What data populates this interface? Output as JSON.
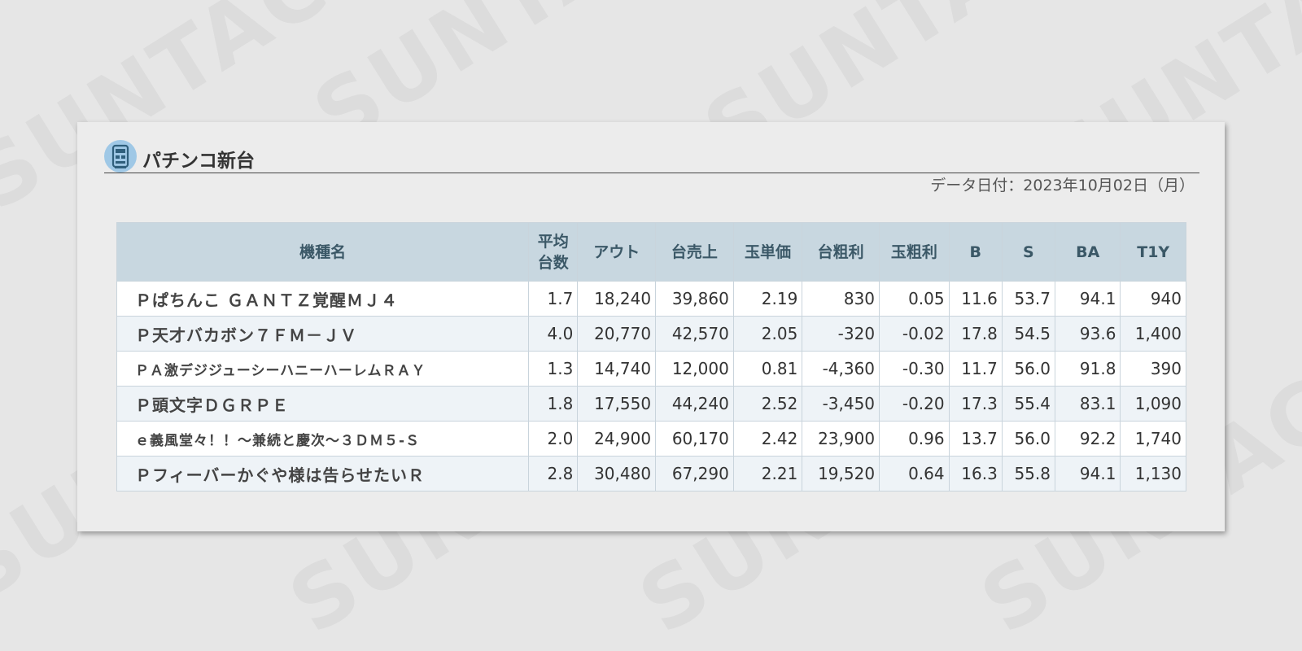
{
  "watermark": {
    "text": "SUNTAC"
  },
  "panel": {
    "title": "パチンコ新台",
    "title_icon": "pachinko-machine-icon",
    "data_date": "データ日付：2023年10月02日（月）"
  },
  "colors": {
    "header_bg": "#c8d7e0",
    "header_text": "#3b5867",
    "row_alt_bg": "#eef3f7",
    "icon_bg": "#9fc8e6"
  },
  "table": {
    "headers": {
      "name": "機種名",
      "avg_units": "平均台数",
      "out": "アウト",
      "sales": "台売上",
      "ball_price": "玉単価",
      "gross_profit": "台粗利",
      "ball_profit": "玉粗利",
      "b": "B",
      "s": "S",
      "ba": "BA",
      "t1y": "T1Y"
    },
    "rows": [
      {
        "name": "Ｐぱちんこ ＧＡＮＴＺ覚醒ＭＪ４",
        "avg_units": "1.7",
        "out": "18,240",
        "sales": "39,860",
        "ball_price": "2.19",
        "gross_profit": "830",
        "ball_profit": "0.05",
        "b": "11.6",
        "s": "53.7",
        "ba": "94.1",
        "t1y": "940"
      },
      {
        "name": "Ｐ天才バカボン７ＦＭ－ＪＶ",
        "avg_units": "4.0",
        "out": "20,770",
        "sales": "42,570",
        "ball_price": "2.05",
        "gross_profit": "-320",
        "ball_profit": "-0.02",
        "b": "17.8",
        "s": "54.5",
        "ba": "93.6",
        "t1y": "1,400"
      },
      {
        "name": "ＰＡ激デジジューシーハニーハーレムＲＡＹ",
        "avg_units": "1.3",
        "out": "14,740",
        "sales": "12,000",
        "ball_price": "0.81",
        "gross_profit": "-4,360",
        "ball_profit": "-0.30",
        "b": "11.7",
        "s": "56.0",
        "ba": "91.8",
        "t1y": "390"
      },
      {
        "name": "Ｐ頭文字ＤＧＲＰＥ",
        "avg_units": "1.8",
        "out": "17,550",
        "sales": "44,240",
        "ball_price": "2.52",
        "gross_profit": "-3,450",
        "ball_profit": "-0.20",
        "b": "17.3",
        "s": "55.4",
        "ba": "83.1",
        "t1y": "1,090"
      },
      {
        "name": "ｅ義風堂々！！～兼続と慶次～３ＤＭ５-Ｓ",
        "avg_units": "2.0",
        "out": "24,900",
        "sales": "60,170",
        "ball_price": "2.42",
        "gross_profit": "23,900",
        "ball_profit": "0.96",
        "b": "13.7",
        "s": "56.0",
        "ba": "92.2",
        "t1y": "1,740"
      },
      {
        "name": "Ｐフィーバーかぐや様は告らせたいＲ",
        "avg_units": "2.8",
        "out": "30,480",
        "sales": "67,290",
        "ball_price": "2.21",
        "gross_profit": "19,520",
        "ball_profit": "0.64",
        "b": "16.3",
        "s": "55.8",
        "ba": "94.1",
        "t1y": "1,130"
      }
    ]
  }
}
